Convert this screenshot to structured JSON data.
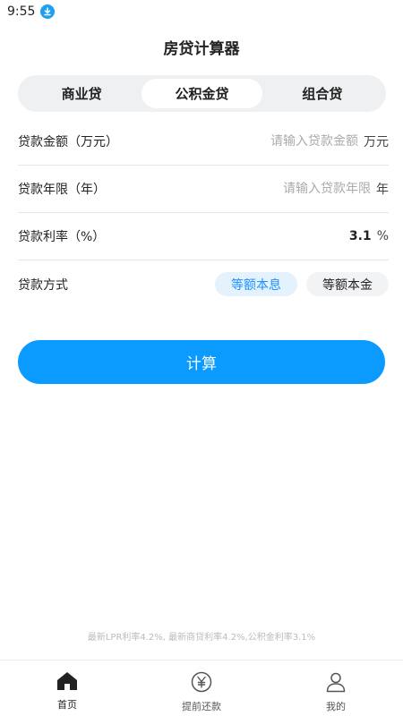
{
  "status_bar": {
    "time": "9:55",
    "download_icon": "download-icon"
  },
  "page": {
    "title": "房贷计算器"
  },
  "tabs": [
    {
      "label": "商业贷",
      "active": false
    },
    {
      "label": "公积金贷",
      "active": true
    },
    {
      "label": "组合贷",
      "active": false
    }
  ],
  "form": {
    "amount": {
      "label": "贷款金额（万元）",
      "placeholder": "请输入贷款金额",
      "value": "",
      "unit": "万元"
    },
    "years": {
      "label": "贷款年限（年）",
      "placeholder": "请输入贷款年限",
      "value": "",
      "unit": "年"
    },
    "rate": {
      "label": "贷款利率（%）",
      "value": "3.1",
      "unit": "%"
    },
    "method": {
      "label": "贷款方式",
      "options": [
        {
          "label": "等额本息",
          "selected": true
        },
        {
          "label": "等额本金",
          "selected": false
        }
      ]
    }
  },
  "calculate_button": {
    "label": "计算"
  },
  "footer": {
    "note": "最新LPR利率4.2%, 最新商贷利率4.2%,公积金利率3.1%"
  },
  "bottom_nav": [
    {
      "label": "首页",
      "icon": "home-icon",
      "active": true
    },
    {
      "label": "提前还款",
      "icon": "yen-icon",
      "active": false
    },
    {
      "label": "我的",
      "icon": "user-icon",
      "active": false
    }
  ],
  "colors": {
    "accent": "#0b9bfe",
    "selected_pill_text": "#1e90ff",
    "selected_pill_bg": "#e3f2fd"
  }
}
